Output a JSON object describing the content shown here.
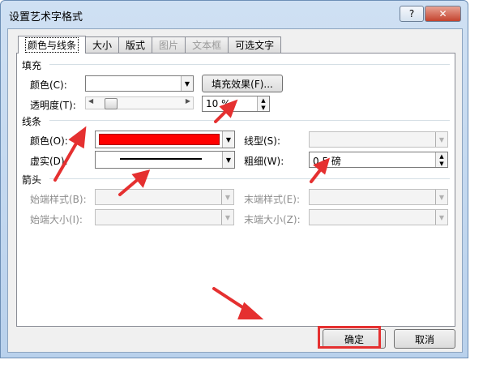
{
  "window": {
    "title": "设置艺术字格式",
    "help_label": "?",
    "close_label": "✕"
  },
  "tabs": [
    {
      "label": "颜色与线条",
      "active": true,
      "disabled": false
    },
    {
      "label": "大小",
      "active": false,
      "disabled": false
    },
    {
      "label": "版式",
      "active": false,
      "disabled": false
    },
    {
      "label": "图片",
      "active": false,
      "disabled": true
    },
    {
      "label": "文本框",
      "active": false,
      "disabled": true
    },
    {
      "label": "可选文字",
      "active": false,
      "disabled": false
    }
  ],
  "fill": {
    "section_label": "填充",
    "color_label": "颜色(C):",
    "fill_effect_label": "填充效果(F)...",
    "transparency_label": "透明度(T):",
    "transparency_value": "10 %",
    "transparency_fraction": 0.1
  },
  "line": {
    "section_label": "线条",
    "color_label": "颜色(O):",
    "color_value": "#ff0000",
    "dash_label": "虚实(D):",
    "style_label": "线型(S):",
    "weight_label": "粗细(W):",
    "weight_value": "0.5 磅"
  },
  "arrows": {
    "section_label": "箭头",
    "begin_style_label": "始端样式(B):",
    "end_style_label": "末端样式(E):",
    "begin_size_label": "始端大小(I):",
    "end_size_label": "末端大小(Z):"
  },
  "buttons": {
    "ok_label": "确定",
    "cancel_label": "取消"
  },
  "icons": {
    "dropdown": "▼",
    "spin_up": "▲",
    "spin_down": "▼",
    "slider_left": "◀",
    "slider_right": "▶"
  },
  "annotation_color": "#e53030"
}
